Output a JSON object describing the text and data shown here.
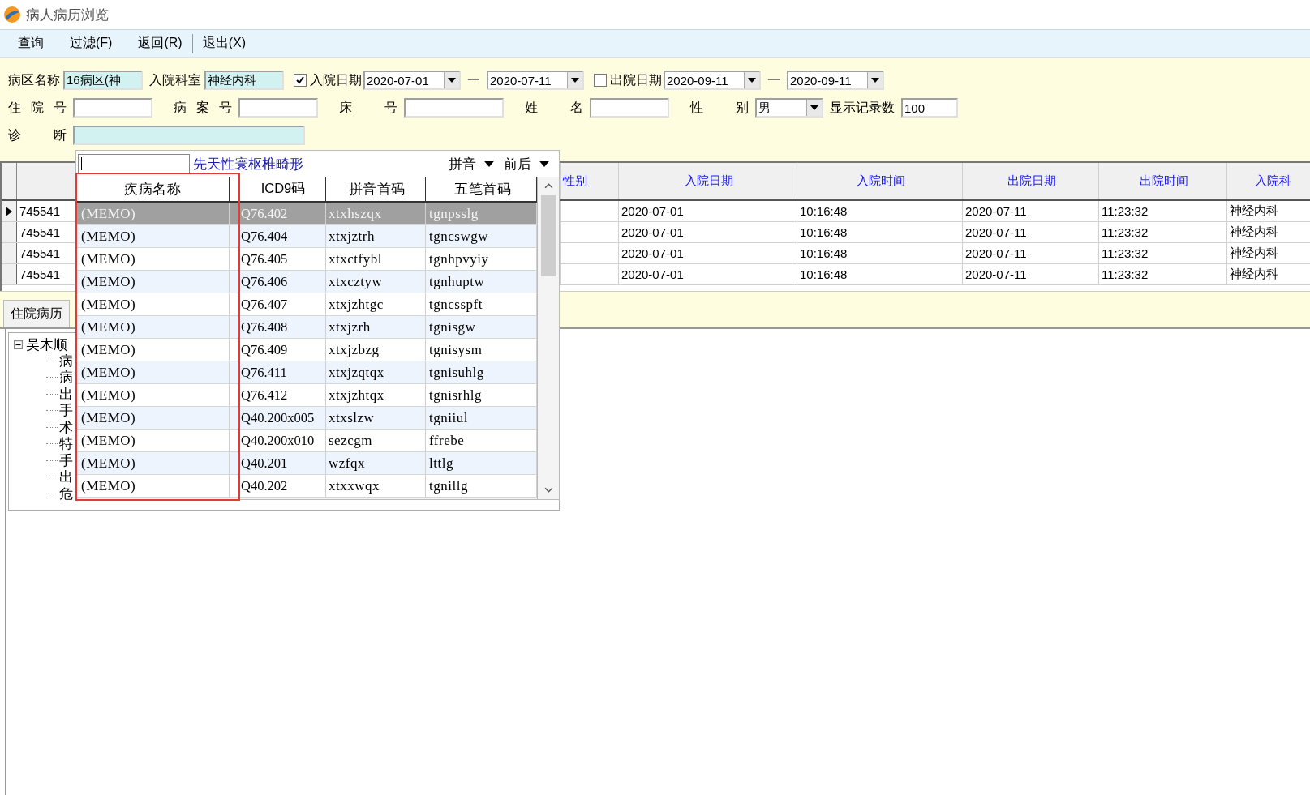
{
  "window": {
    "title": "病人病历浏览"
  },
  "menu": [
    {
      "label": "查询",
      "separator": false
    },
    {
      "label": "过滤(F)",
      "separator": false
    },
    {
      "label": "返回(R)",
      "separator": true
    },
    {
      "label": "退出(X)",
      "separator": false
    }
  ],
  "filters": [
    [
      {
        "kind": "text",
        "label": "病区名称",
        "value": "16病区(神",
        "tinted": true
      },
      {
        "kind": "text",
        "label": "入院科室",
        "value": "神经内科",
        "tinted": true
      },
      {
        "kind": "check",
        "label": "入院日期",
        "checked": true
      },
      {
        "kind": "date",
        "value": "2020-07-01"
      },
      {
        "kind": "dash",
        "text": "一"
      },
      {
        "kind": "date",
        "value": "2020-07-11"
      },
      {
        "kind": "check",
        "label": "出院日期",
        "checked": false
      },
      {
        "kind": "date",
        "value": "2020-09-11"
      },
      {
        "kind": "dash",
        "text": "一"
      },
      {
        "kind": "date",
        "value": "2020-09-11"
      }
    ],
    [
      {
        "kind": "text",
        "label": "住 院 号",
        "tinted": false
      },
      {
        "kind": "text",
        "label": "病 案 号",
        "tinted": false
      },
      {
        "kind": "text",
        "label": "床 号",
        "tinted": false
      },
      {
        "kind": "text",
        "label": "姓 名",
        "tinted": false
      },
      {
        "kind": "select",
        "label": "性 别",
        "value": "男"
      },
      {
        "kind": "text",
        "label": "显示记录数",
        "value": "100",
        "tinted": false
      }
    ],
    [
      {
        "kind": "text",
        "label": "诊 断",
        "tinted": true
      }
    ]
  ],
  "grid": {
    "columns": [
      {
        "label": "性别"
      },
      {
        "label": "入院日期"
      },
      {
        "label": "入院时间"
      },
      {
        "label": "出院日期"
      },
      {
        "label": "出院时间"
      },
      {
        "label": "入院科"
      }
    ],
    "rows": [
      {
        "selected": true,
        "id": "745541",
        "cells": [
          "",
          "2020-07-01",
          "10:16:48",
          "2020-07-11",
          "11:23:32",
          "神经内科"
        ]
      },
      {
        "selected": false,
        "id": "745541",
        "cells": [
          "",
          "2020-07-01",
          "10:16:48",
          "2020-07-11",
          "11:23:32",
          "神经内科"
        ]
      },
      {
        "selected": false,
        "id": "745541",
        "cells": [
          "",
          "2020-07-01",
          "10:16:48",
          "2020-07-11",
          "11:23:32",
          "神经内科"
        ]
      },
      {
        "selected": false,
        "id": "745541",
        "cells": [
          "",
          "2020-07-01",
          "10:16:48",
          "2020-07-11",
          "11:23:32",
          "神经内科"
        ]
      }
    ]
  },
  "tabs": [
    {
      "label": "住院病历",
      "selected": true
    }
  ],
  "tree": {
    "label": "吴木顺",
    "expanded": true,
    "children": [
      {
        "label": "病"
      },
      {
        "label": "病"
      },
      {
        "label": "出"
      },
      {
        "label": "手"
      },
      {
        "label": "术"
      },
      {
        "label": "特"
      },
      {
        "label": "手"
      },
      {
        "label": "出"
      },
      {
        "label": "危"
      }
    ]
  },
  "lookup": {
    "hint": "先天性寰枢椎畸形",
    "options": [
      {
        "label": "拼音"
      },
      {
        "label": "前后"
      }
    ],
    "columns": [
      {
        "label": "疾病名称"
      },
      {
        "label": "ICD9码"
      },
      {
        "label": "拼音首码"
      },
      {
        "label": "五笔首码"
      }
    ],
    "rows": [
      {
        "selected": true,
        "cells": [
          "(MEMO)",
          "Q76.402",
          "xtxhszqx",
          "tgnpsslg"
        ]
      },
      {
        "selected": false,
        "cells": [
          "(MEMO)",
          "Q76.404",
          "xtxjztrh",
          "tgncswgw"
        ]
      },
      {
        "selected": false,
        "cells": [
          "(MEMO)",
          "Q76.405",
          "xtxctfybl",
          "tgnhpvyiy"
        ]
      },
      {
        "selected": false,
        "cells": [
          "(MEMO)",
          "Q76.406",
          "xtxcztyw",
          "tgnhuptw"
        ]
      },
      {
        "selected": false,
        "cells": [
          "(MEMO)",
          "Q76.407",
          "xtxjzhtgc",
          "tgncsspft"
        ]
      },
      {
        "selected": false,
        "cells": [
          "(MEMO)",
          "Q76.408",
          "xtxjzrh",
          "tgnisgw"
        ]
      },
      {
        "selected": false,
        "cells": [
          "(MEMO)",
          "Q76.409",
          "xtxjzbzg",
          "tgnisysm"
        ]
      },
      {
        "selected": false,
        "cells": [
          "(MEMO)",
          "Q76.411",
          "xtxjzqtqx",
          "tgnisuhlg"
        ]
      },
      {
        "selected": false,
        "cells": [
          "(MEMO)",
          "Q76.412",
          "xtxjzhtqx",
          "tgnisrhlg"
        ]
      },
      {
        "selected": false,
        "cells": [
          "(MEMO)",
          "Q40.200x005",
          "xtxslzw",
          "tgniiul"
        ]
      },
      {
        "selected": false,
        "cells": [
          "(MEMO)",
          "Q40.200x010",
          "sezcgm",
          "ffrebe"
        ]
      },
      {
        "selected": false,
        "cells": [
          "(MEMO)",
          "Q40.201",
          "wzfqx",
          "lttlg"
        ]
      },
      {
        "selected": false,
        "cells": [
          "(MEMO)",
          "Q40.202",
          "xtxxwqx",
          "tgnillg"
        ]
      }
    ]
  }
}
